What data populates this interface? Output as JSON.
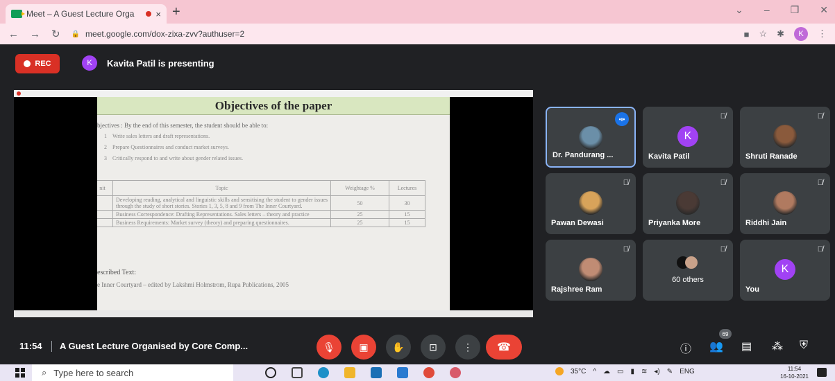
{
  "browser": {
    "tab_title": "Meet – A Guest Lecture Orga",
    "tab_close": "×",
    "new_tab": "+",
    "url": "meet.google.com/dox-zixa-zvv?authuser=2",
    "profile_initial": "K",
    "window_controls": [
      "⌄",
      "–",
      "❐",
      "✕"
    ]
  },
  "meet": {
    "rec_label": "REC",
    "presenter_initial": "K",
    "presenter_text": "Kavita Patil is presenting",
    "slide": {
      "title": "Objectives of the paper",
      "intro": "bjectives : By the end of this semester, the student should be able to:",
      "objectives": [
        {
          "n": "1",
          "text": "Write sales letters and draft representations."
        },
        {
          "n": "2",
          "text": "Prepare Questionnaires and conduct market surveys."
        },
        {
          "n": "3",
          "text": "Critically respond to and write about gender related issues."
        }
      ],
      "table_headers": [
        "nit",
        "Topic",
        "Weightage %",
        "Lectures"
      ],
      "table_rows": [
        {
          "unit": "",
          "topic": "Developing reading, analytical and linguistic skills and sensitising the student to gender issues through the study of short stories. Stories 1, 3, 5, 8 and 9 from The Inner Courtyard.",
          "weightage": "50",
          "lectures": "30"
        },
        {
          "unit": "",
          "topic": "Business Correspondence: Drafting Representations. Sales letters – theory and practice",
          "weightage": "25",
          "lectures": "15"
        },
        {
          "unit": "",
          "topic": "Business Requirements: Market survey (theory) and preparing questionnaires.",
          "weightage": "25",
          "lectures": "15"
        }
      ],
      "prescribed_heading": "escribed Text:",
      "prescribed_text": "e Inner Courtyard – edited by Lakshmi Holmstrom, Rupa Publications, 2005"
    },
    "participants": [
      {
        "name": "Dr. Pandurang ...",
        "type": "photo",
        "color": "#6b8fa8",
        "speaking": true
      },
      {
        "name": "Kavita Patil",
        "type": "letter",
        "initial": "K"
      },
      {
        "name": "Shruti Ranade",
        "type": "photo",
        "color": "#8a5a3c"
      },
      {
        "name": "Pawan Dewasi",
        "type": "photo",
        "color": "#d8a35a"
      },
      {
        "name": "Priyanka More",
        "type": "photo",
        "color": "#4a3a35"
      },
      {
        "name": "Riddhi Jain",
        "type": "photo",
        "color": "#b07a60"
      },
      {
        "name": "Rajshree Ram",
        "type": "photo",
        "color": "#c08c74"
      },
      {
        "name": "60 others",
        "type": "group"
      },
      {
        "name": "You",
        "type": "letter",
        "initial": "K"
      }
    ],
    "mute_icon": "🎙̸",
    "speaking_icon": "•ı•",
    "bottom": {
      "time": "11:54",
      "title": "A Guest Lecture Organised by Core Comp...",
      "people_count": "69",
      "controls": [
        "mic-off",
        "camera-off",
        "raise-hand",
        "present",
        "more",
        "end-call"
      ]
    }
  },
  "taskbar": {
    "search_placeholder": "Type here to search",
    "weather": "35°C",
    "language": "ENG",
    "time": "11:54",
    "date": "16-10-2021"
  }
}
